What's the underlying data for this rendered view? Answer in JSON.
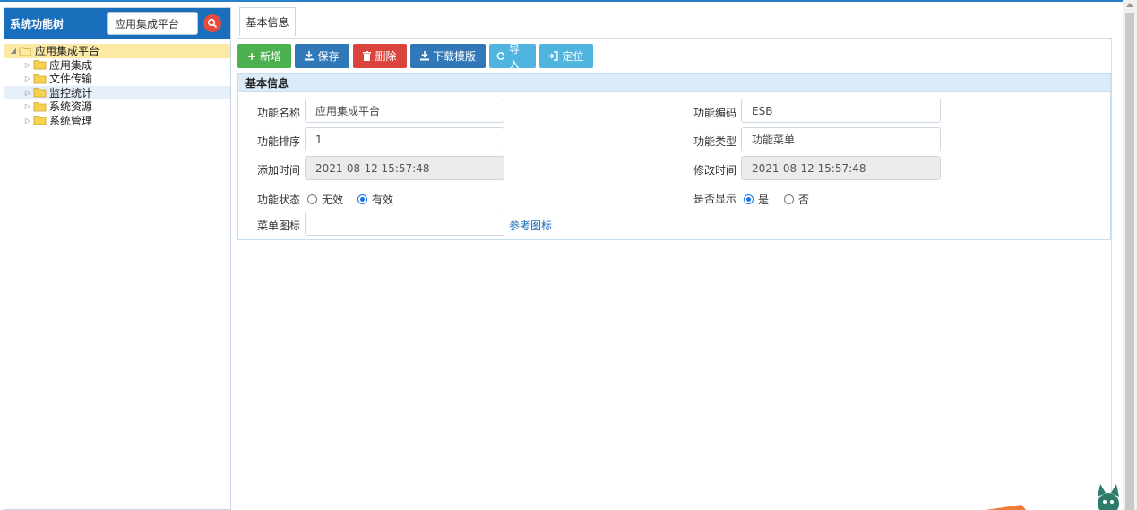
{
  "sidebar": {
    "title": "系统功能树",
    "search_value": "应用集成平台",
    "tree": {
      "root": "应用集成平台",
      "children": [
        "应用集成",
        "文件传输",
        "监控统计",
        "系统资源",
        "系统管理"
      ]
    }
  },
  "tabs": [
    {
      "label": "基本信息"
    }
  ],
  "toolbar": {
    "add": "新增",
    "save": "保存",
    "delete": "删除",
    "download": "下载模版",
    "import": "导入",
    "locate": "定位"
  },
  "form": {
    "section_title": "基本信息",
    "name_label": "功能名称",
    "name_value": "应用集成平台",
    "code_label": "功能编码",
    "code_value": "ESB",
    "order_label": "功能排序",
    "order_value": "1",
    "type_label": "功能类型",
    "type_value": "功能菜单",
    "add_time_label": "添加时间",
    "add_time_value": "2021-08-12 15:57:48",
    "mod_time_label": "修改时间",
    "mod_time_value": "2021-08-12 15:57:48",
    "status_label": "功能状态",
    "status_options": [
      "无效",
      "有效"
    ],
    "status_selected": "有效",
    "display_label": "是否显示",
    "display_options": [
      "是",
      "否"
    ],
    "display_selected": "是",
    "icon_label": "菜单图标",
    "icon_value": "",
    "icon_link": "参考图标"
  },
  "colors": {
    "primary_blue": "#1a6fbd",
    "green": "#4caf50",
    "red": "#d9443c",
    "cyan": "#4fb5df",
    "section_bg": "#dbebf8"
  }
}
